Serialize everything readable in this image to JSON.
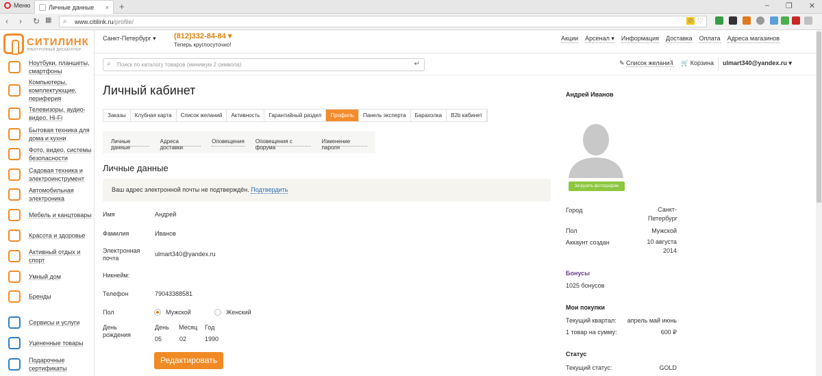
{
  "browser": {
    "menu_label": "Меню",
    "tab_title": "Личные данные",
    "url_host": "www.citilink.ru",
    "url_path": "/profile/"
  },
  "logo": {
    "name": "СИТИЛИНК",
    "tagline": "ЭЛЕКТРОННЫЙ ДИСКАУНТЕР"
  },
  "sidebar": {
    "categories": [
      {
        "label": "Ноутбуки, планшеты, смартфоны"
      },
      {
        "label": "Компьютеры, комплектующие, периферия"
      },
      {
        "label": "Телевизоры, аудио-видео, Hi-Fi"
      },
      {
        "label": "Бытовая техника для дома и кухни"
      },
      {
        "label": "Фото, видео, системы безопасности"
      },
      {
        "label": "Садовая техника и электроинструмент"
      },
      {
        "label": "Автомобильная электроника"
      },
      {
        "label": "Мебель и канцтовары"
      },
      {
        "label": "Красота и здоровье"
      },
      {
        "label": "Активный отдых и спорт"
      },
      {
        "label": "Умный дом"
      },
      {
        "label": "Бренды"
      },
      {
        "label": "Сервисы и услуги"
      },
      {
        "label": "Уцененные товары"
      },
      {
        "label": "Подарочные сертификаты"
      }
    ]
  },
  "header": {
    "city": "Санкт-Петербург ▾",
    "phone": "(812)332-84-84 ▾",
    "phone_note": "Теперь круглосуточно!",
    "nav": [
      "Акции",
      "Арсенал ▾",
      "Информация",
      "Доставка",
      "Оплата",
      "Адреса магазинов"
    ],
    "search_placeholder": "Поиск по каталогу товаров (минимум 2 символа)",
    "wishlist": "Список желаний",
    "cart": "Корзина",
    "user": "ulmart340@yandex.ru ▾"
  },
  "page": {
    "title": "Личный кабинет",
    "tabs": [
      "Заказы",
      "Клубная карта",
      "Список желаний",
      "Активность",
      "Гарантийный раздел",
      "Профиль",
      "Панель эксперта",
      "Барахолка",
      "B2b кабинет"
    ],
    "active_tab": "Профиль",
    "subtabs": [
      "Личные данные",
      "Адреса доставки",
      "Оповещения",
      "Оповещения с форума",
      "Изменение пароля"
    ],
    "section_title": "Личные данные",
    "notice_text": "Ваш адрес электронной почты не подтверждён.",
    "notice_link": "Подтвердить"
  },
  "form": {
    "name_label": "Имя",
    "name": "Андрей",
    "surname_label": "Фамилия",
    "surname": "Иванов",
    "email_label_1": "Электронная",
    "email_label_2": "почта",
    "email": "ulmart340@yandex.ru",
    "nick_label": "Никнейм:",
    "phone_label": "Телефон",
    "phone": "79043388581",
    "gender_label": "Пол",
    "gender_male": "Мужской",
    "gender_female": "Женский",
    "gender_selected": "Мужской",
    "birth_label_1": "День",
    "birth_label_2": "рождения",
    "day_h": "День",
    "month_h": "Месяц",
    "year_h": "Год",
    "day": "05",
    "month": "02",
    "year": "1990",
    "edit_button": "Редактировать"
  },
  "profile": {
    "full_name": "Андрей Иванов",
    "upload_label": "Загрузить фотографию",
    "city_label": "Город",
    "city_1": "Санкт-",
    "city_2": "Петербург",
    "gender_label": "Пол",
    "gender": "Мужской",
    "created_label": "Аккаунт создан",
    "created_1": "10 августа",
    "created_2": "2014",
    "bonus_title": "Бонусы",
    "bonus_value": "1025 бонусов",
    "purchases_title": "Мои покупки",
    "quarter_label": "Текущий квартал:",
    "quarter_value": "апрель май июнь",
    "sum_label": "1 товар на сумму:",
    "sum_value": "600 ₽",
    "status_title": "Статус",
    "status_label": "Текущий статус:",
    "status_value": "GOLD"
  }
}
